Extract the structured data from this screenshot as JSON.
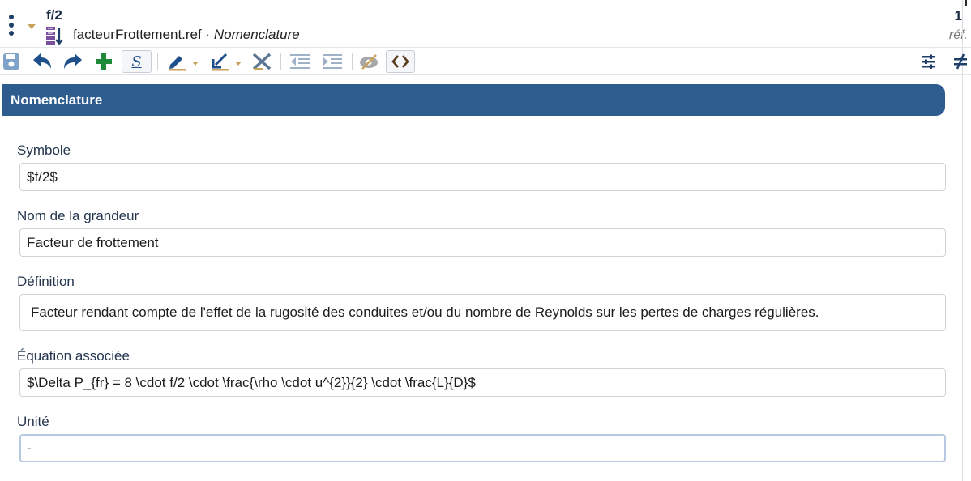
{
  "header": {
    "title": "f/2",
    "file_name": "facteurFrottement.ref",
    "separator": "·",
    "context": "Nomenclature",
    "ref_count": "1",
    "ref_label": "réf."
  },
  "toolbar": {
    "underline_label": "S",
    "icons": [
      "save-icon",
      "undo-icon",
      "redo-icon",
      "add-icon",
      "underline-icon",
      "highlight-pen-icon",
      "format-arrow-icon",
      "clear-format-icon",
      "outdent-icon",
      "indent-icon",
      "visibility-icon",
      "code-icon",
      "filter-icon",
      "not-equal-icon"
    ]
  },
  "section": {
    "title": "Nomenclature"
  },
  "fields": {
    "symbol": {
      "label": "Symbole",
      "value": "$f/2$"
    },
    "name": {
      "label": "Nom de la grandeur",
      "value": "Facteur de frottement"
    },
    "definition": {
      "label": "Définition",
      "value": "Facteur rendant compte de l'effet de la rugosité des conduites et/ou du nombre de Reynolds sur les pertes de charges régulières."
    },
    "equation": {
      "label": "Équation associée",
      "value": "$\\Delta P_{fr} = 8 \\cdot f/2 \\cdot \\frac{\\rho \\cdot u^{2}}{2} \\cdot \\frac{L}{D}$"
    },
    "unit": {
      "label": "Unité",
      "value": "-"
    }
  },
  "colors": {
    "accent": "#2f5c8f",
    "icon_blue": "#1f4f8a",
    "icon_green": "#1e8a3a",
    "icon_gold": "#c9a25b"
  }
}
